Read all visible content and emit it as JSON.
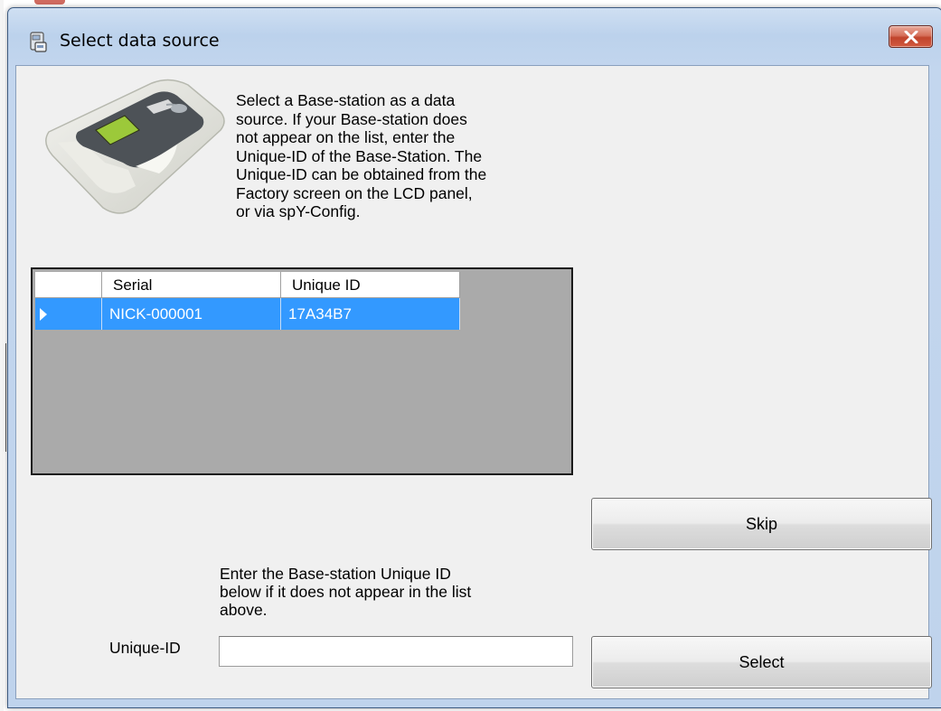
{
  "window": {
    "title": "Select data source",
    "close_symbol": "✕"
  },
  "info_text": "Select a Base-station as a data\nsource. If your Base-station does\nnot appear on the list, enter the\nUnique-ID of the Base-Station. The\nUnique-ID can be obtained from the\nFactory screen on the LCD panel,\nor via spY-Config.",
  "grid": {
    "columns": [
      "Serial",
      "Unique ID"
    ],
    "rows": [
      {
        "serial": "NICK-000001",
        "unique_id": "17A34B7",
        "selected": true
      }
    ],
    "selection_color": "#3399ff"
  },
  "buttons": {
    "skip": "Skip",
    "select": "Select"
  },
  "enter_text": "Enter the Base-station Unique ID\nbelow if it does not appear in the list\nabove.",
  "unique_id_field": {
    "label": "Unique-ID",
    "value": "",
    "placeholder": ""
  },
  "icons": {
    "title": "app-icon",
    "close": "close-icon",
    "row_indicator": "row-selector-arrow-icon",
    "device": "base-station-device-icon"
  }
}
